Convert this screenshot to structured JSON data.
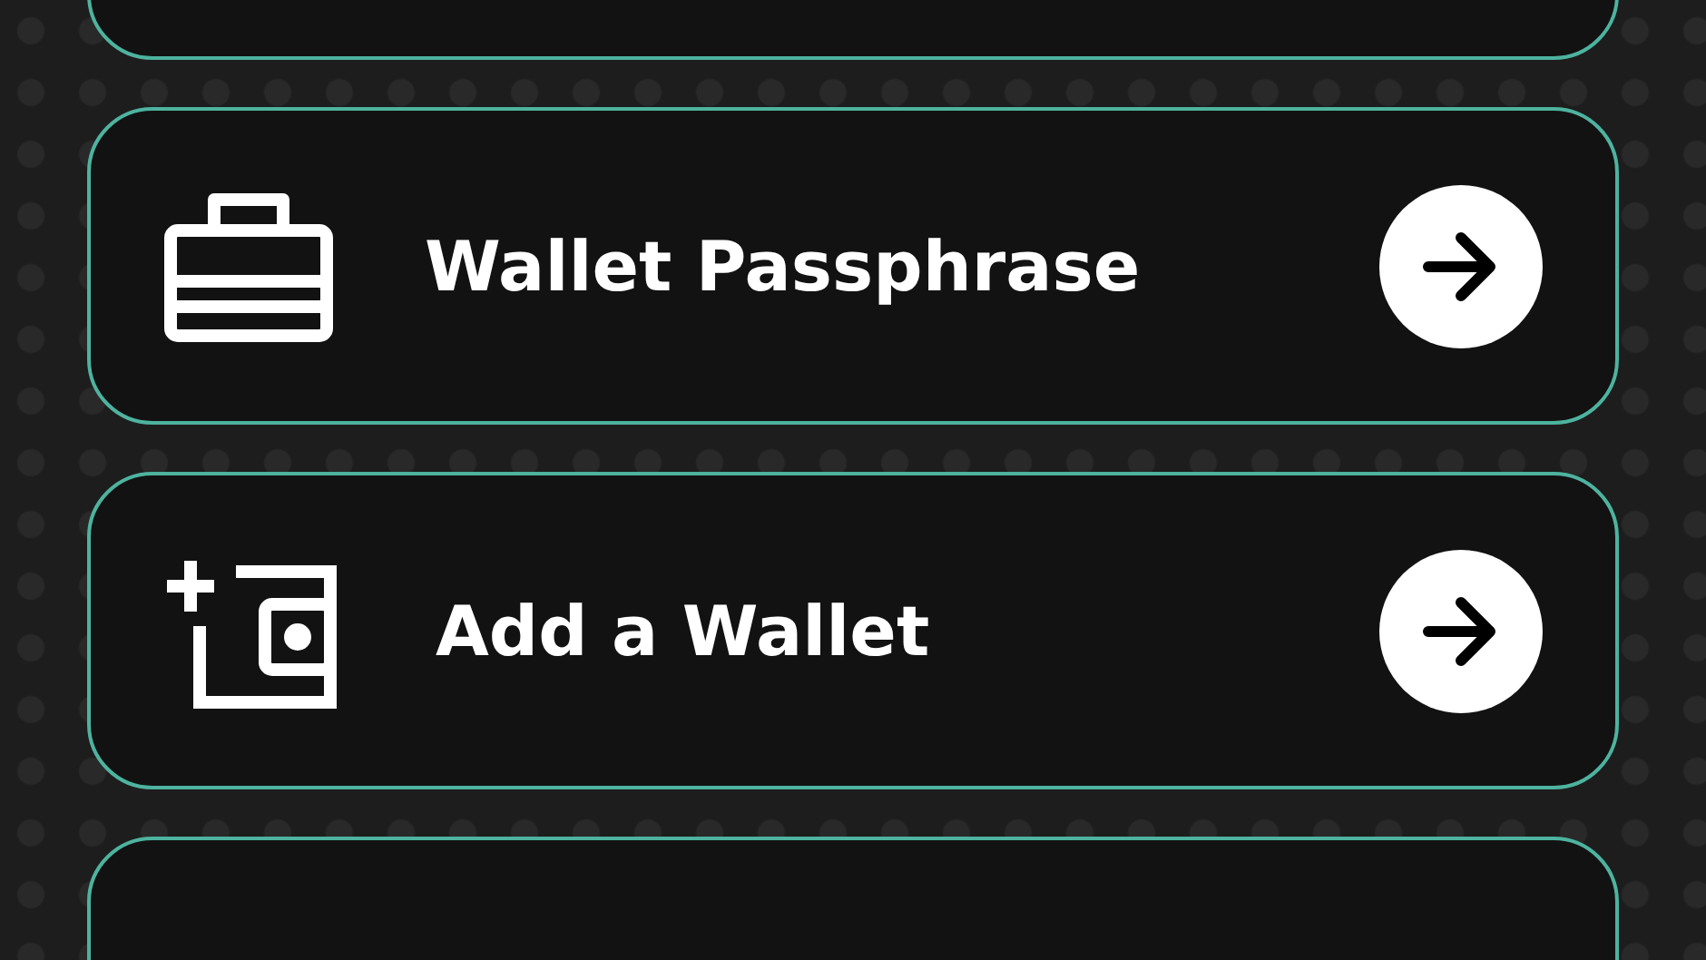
{
  "menu_items": [
    {
      "kind": "passphrase",
      "label": "Wallet Passphrase"
    },
    {
      "kind": "add",
      "label": "Add a Wallet"
    }
  ]
}
